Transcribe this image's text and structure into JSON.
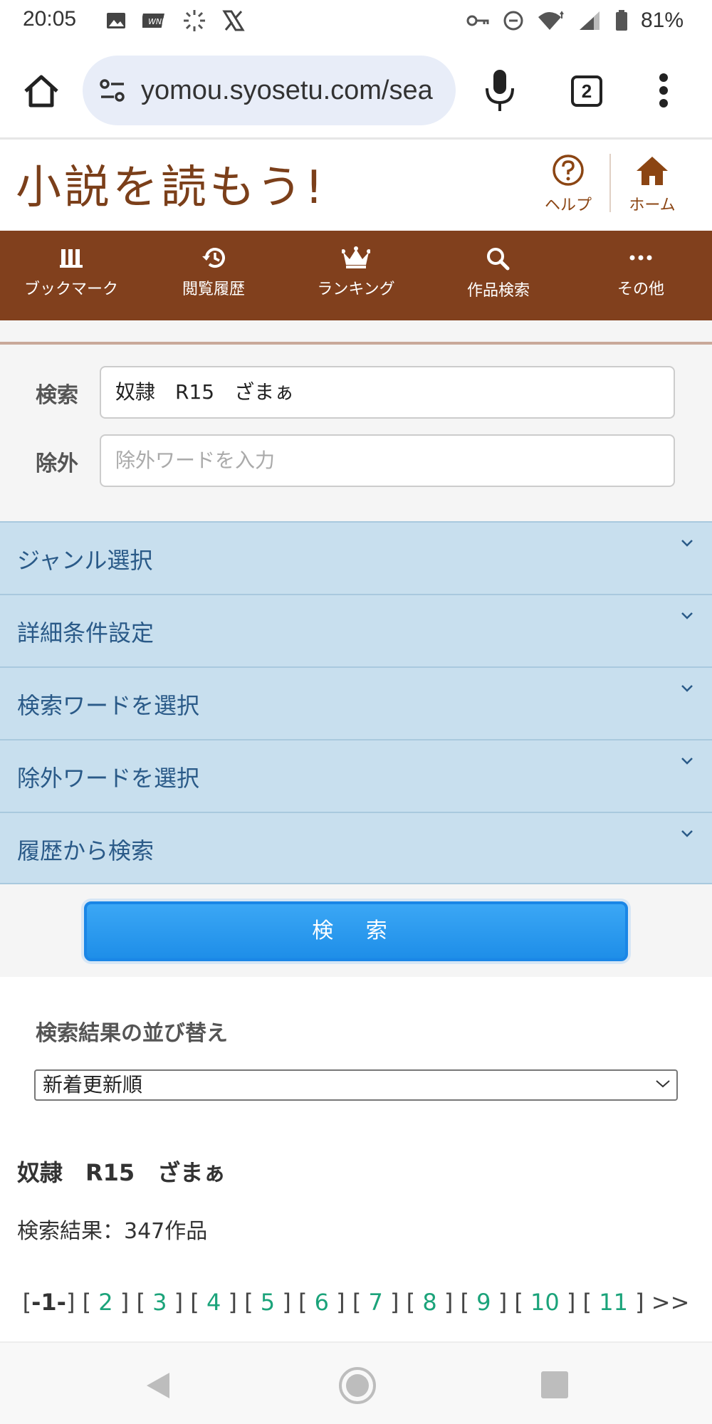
{
  "status": {
    "time": "20:05",
    "battery": "81%"
  },
  "browser": {
    "url": "yomou.syosetu.com/sea",
    "tab_count": "2"
  },
  "site": {
    "logo": "小説を読もう!",
    "help_label": "ヘルプ",
    "home_label": "ホーム"
  },
  "nav": {
    "items": [
      {
        "label": "ブックマーク",
        "icon": "bookmark-icon"
      },
      {
        "label": "閲覧履歴",
        "icon": "history-icon"
      },
      {
        "label": "ランキング",
        "icon": "crown-icon"
      },
      {
        "label": "作品検索",
        "icon": "search-icon"
      },
      {
        "label": "その他",
        "icon": "more-icon"
      }
    ]
  },
  "search": {
    "keyword_label": "検索",
    "keyword_value": "奴隷　R15　ざまぁ",
    "exclude_label": "除外",
    "exclude_placeholder": "除外ワードを入力"
  },
  "accordion": [
    {
      "label": "ジャンル選択"
    },
    {
      "label": "詳細条件設定"
    },
    {
      "label": "検索ワードを選択"
    },
    {
      "label": "除外ワードを選択"
    },
    {
      "label": "履歴から検索"
    }
  ],
  "search_button": "検 索",
  "sort": {
    "title": "検索結果の並び替え",
    "selected": "新着更新順"
  },
  "results": {
    "query": "奴隷　R15　ざまぁ",
    "count": "検索結果：347作品"
  },
  "pager": {
    "current": "-1-",
    "pages": [
      "2",
      "3",
      "4",
      "5",
      "6",
      "7",
      "8",
      "9",
      "10",
      "11"
    ],
    "next": ">>"
  },
  "colors": {
    "brand_brown": "#81401d",
    "accordion_bg": "#c8dfee",
    "button_blue": "#1e8ee8",
    "link_green": "#1ba37a"
  }
}
